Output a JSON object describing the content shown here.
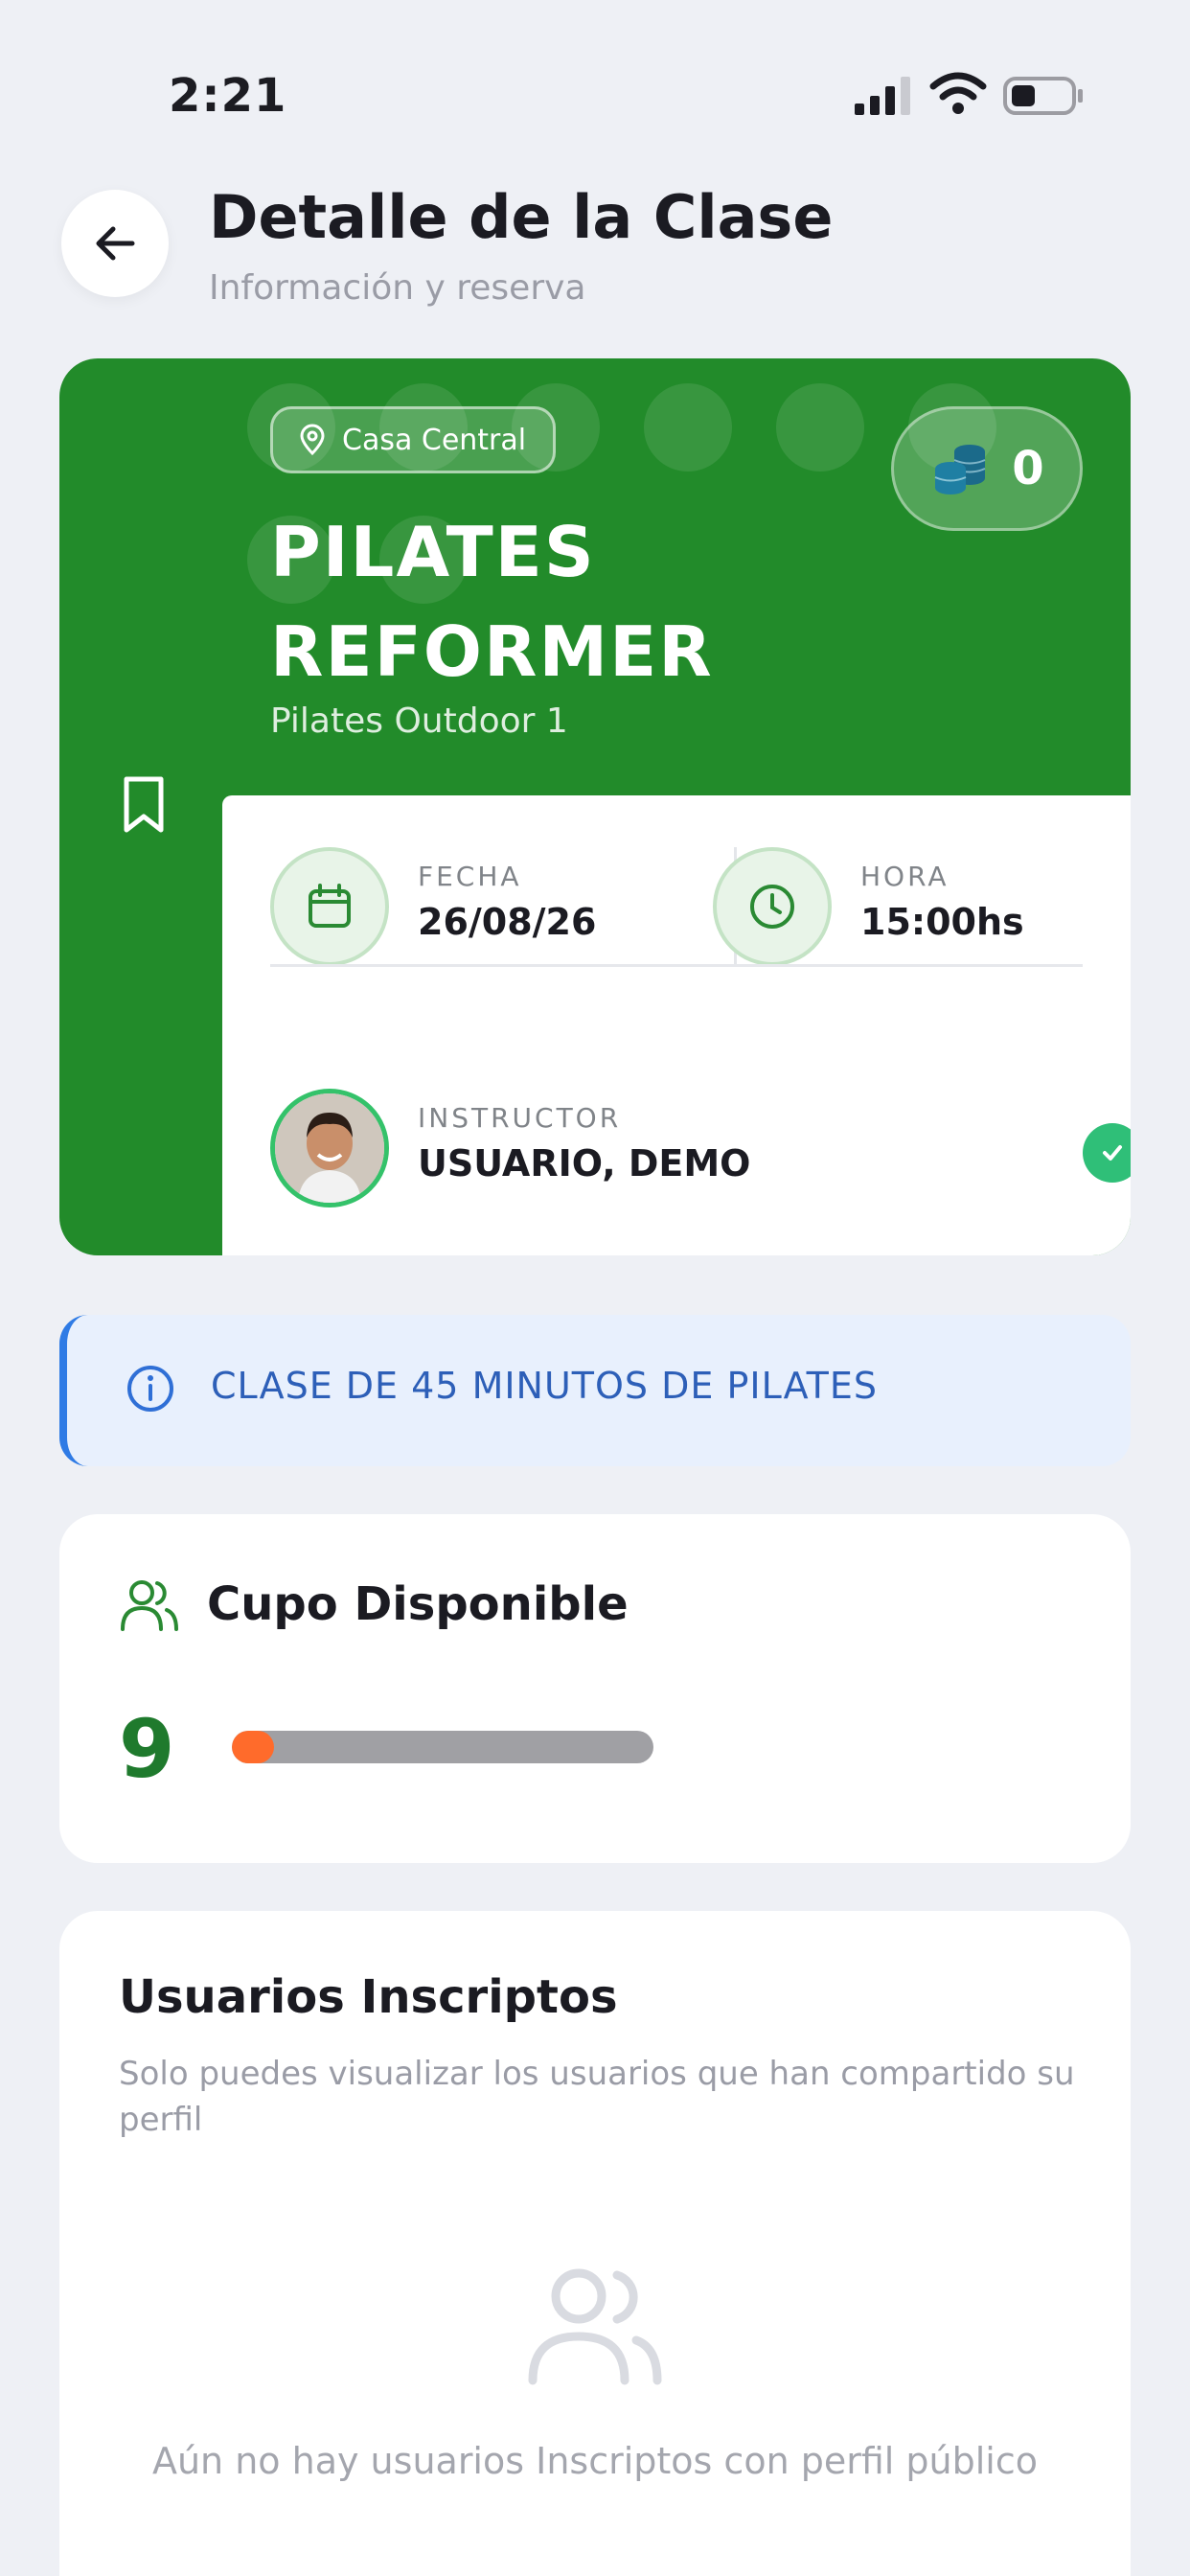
{
  "status_bar": {
    "time": "2:21"
  },
  "header": {
    "title": "Detalle de la Clase",
    "subtitle": "Información y reserva"
  },
  "class": {
    "location": "Casa Central",
    "credits": "0",
    "name_line1": "PILATES",
    "name_line2": "REFORMER",
    "room": "Pilates Outdoor 1",
    "date_label": "FECHA",
    "date_value": "26/08/26",
    "time_label": "HORA",
    "time_value": "15:00hs",
    "instructor_label": "INSTRUCTOR",
    "instructor_name": "USUARIO, DEMO",
    "brand_color": "#228b2a"
  },
  "description": {
    "text": "CLASE DE 45 MINUTOS DE PILATES"
  },
  "capacity": {
    "title": "Cupo Disponible",
    "available": "9",
    "fill_fraction": 0.1
  },
  "enrolled": {
    "title": "Usuarios Inscriptos",
    "note": "Solo puedes visualizar los usuarios que han compartido su perfil",
    "empty_text": "Aún no hay usuarios Inscriptos con perfil público"
  },
  "icons": {
    "back": "arrow-left-icon",
    "location": "map-pin-icon",
    "credits": "coins-icon",
    "bookmark": "bookmark-icon",
    "date": "calendar-icon",
    "time": "clock-icon",
    "verified": "check-icon",
    "info": "info-icon",
    "users": "users-icon"
  }
}
